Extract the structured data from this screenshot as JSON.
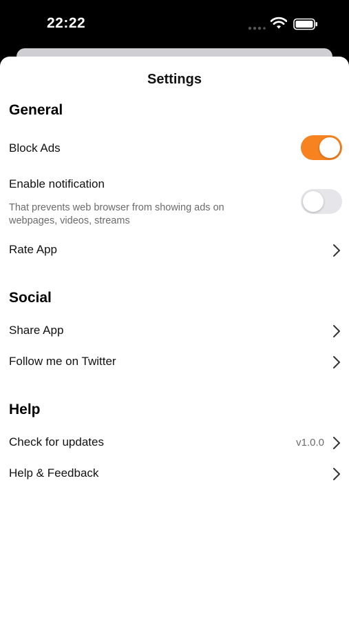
{
  "status_bar": {
    "time": "22:22"
  },
  "sheet": {
    "title": "Settings"
  },
  "sections": {
    "general": {
      "header": "General",
      "block_ads": {
        "label": "Block Ads",
        "enabled": true
      },
      "notification": {
        "label": "Enable notification",
        "description": "That prevents web browser from showing ads on webpages, videos, streams",
        "enabled": false
      },
      "rate_app": {
        "label": "Rate App"
      }
    },
    "social": {
      "header": "Social",
      "share_app": {
        "label": "Share App"
      },
      "twitter": {
        "label": "Follow me on Twitter"
      }
    },
    "help": {
      "header": "Help",
      "updates": {
        "label": "Check for updates",
        "value": "v1.0.0"
      },
      "feedback": {
        "label": "Help & Feedback"
      }
    }
  },
  "colors": {
    "accent": "#f68320",
    "toggle_off": "#e5e5ea",
    "secondary_text": "#6b6b6b"
  },
  "icons": [
    "signal-icon",
    "wifi-icon",
    "battery-icon",
    "chevron-right-icon"
  ]
}
